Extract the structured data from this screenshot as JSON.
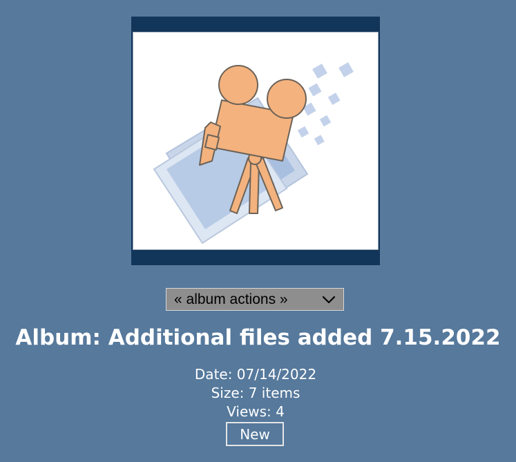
{
  "album": {
    "thumbnail_icon": "video-camera-icon",
    "actions_select": {
      "label": "« album actions »",
      "icon": "chevron-down-icon"
    },
    "title": "Album: Additional files added 7.15.2022",
    "date": "Date: 07/14/2022",
    "size": "Size: 7 items",
    "views": "Views: 4",
    "status_badge": "New"
  },
  "colors": {
    "background": "#56799c",
    "thumbnail_border": "#12355a",
    "select_background": "#8e8e8e",
    "camera_fill": "#f4b27e",
    "text": "#ffffff"
  }
}
